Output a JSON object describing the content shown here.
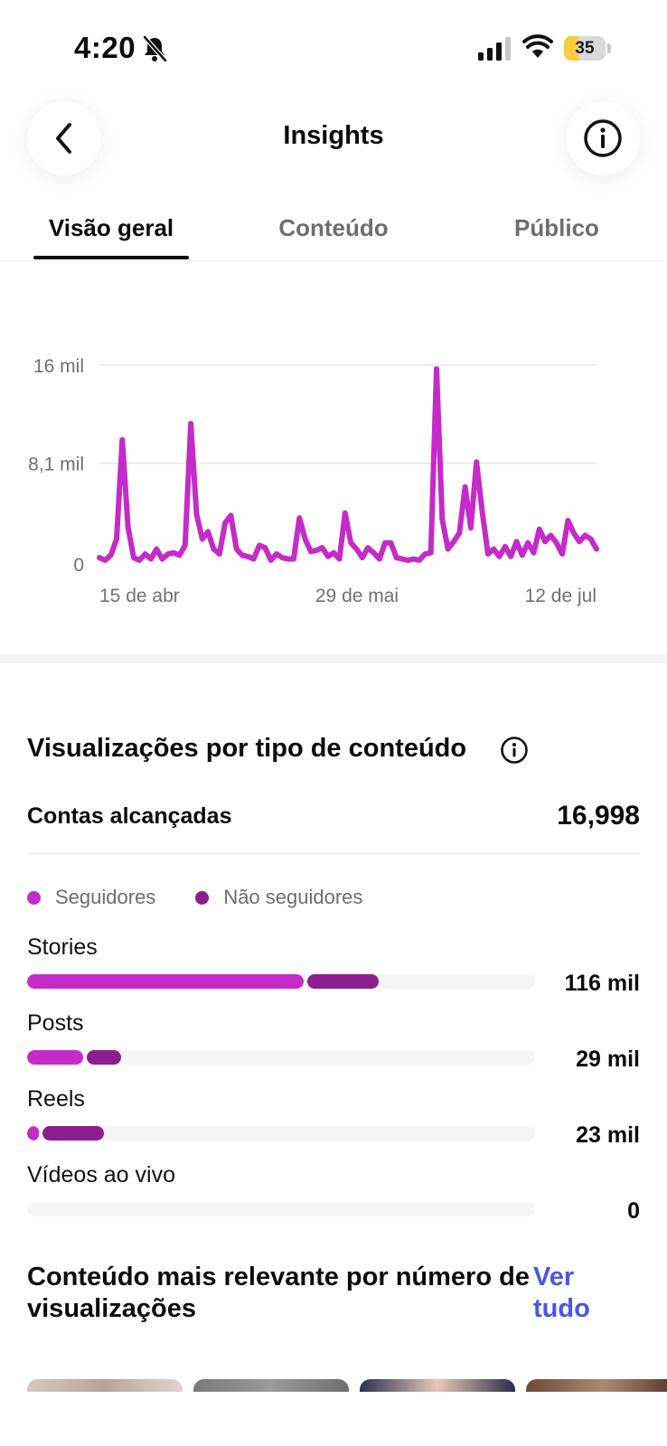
{
  "status_bar": {
    "time": "4:20",
    "battery_level": "35"
  },
  "header": {
    "title": "Insights",
    "back_icon": "chevron-left-icon",
    "info_icon": "info-icon"
  },
  "tabs": [
    {
      "label": "Visão geral",
      "active": true
    },
    {
      "label": "Conteúdo",
      "active": false
    },
    {
      "label": "Público",
      "active": false
    }
  ],
  "chart_data": {
    "type": "line",
    "series": [
      {
        "color": "#c52bc8",
        "values": [
          500,
          300,
          700,
          2000,
          10000,
          3000,
          500,
          300,
          800,
          400,
          1200,
          400,
          800,
          900,
          700,
          1500,
          11300,
          4000,
          2000,
          2600,
          1200,
          800,
          3300,
          3900,
          1200,
          700,
          600,
          400,
          1500,
          1300,
          300,
          800,
          500,
          400,
          400,
          3700,
          2000,
          1000,
          1100,
          1300,
          600,
          900,
          400,
          4100,
          1700,
          1200,
          500,
          1300,
          900,
          400,
          1700,
          1700,
          500,
          400,
          300,
          400,
          300,
          800,
          900,
          15700,
          3600,
          1200,
          1800,
          2500,
          6200,
          2900,
          8200,
          4200,
          800,
          1200,
          600,
          1400,
          600,
          1800,
          700,
          1700,
          900,
          2800,
          1800,
          2300,
          1700,
          800,
          3500,
          2500,
          1800,
          2300,
          2000,
          1200
        ]
      }
    ],
    "x_tick_labels": [
      "15 de abr",
      "29 de mai",
      "12 de jul"
    ],
    "y_tick_labels": [
      "16 mil",
      "8,1 mil",
      "0"
    ],
    "y_tick_values": [
      16000,
      8100,
      0
    ],
    "ylim": [
      0,
      16000
    ],
    "grid": true
  },
  "views_by_type": {
    "title": "Visualizações por tipo de conteúdo",
    "reach_label": "Contas alcançadas",
    "reach_value": "16,998",
    "legend": [
      {
        "label": "Seguidores",
        "color": "#c52bc8"
      },
      {
        "label": "Não seguidores",
        "color": "#8d1e8f"
      }
    ],
    "rows": [
      {
        "label": "Stories",
        "value": "116 mil",
        "followers_fraction": 0.545,
        "non_followers_fraction": 0.14
      },
      {
        "label": "Posts",
        "value": "29 mil",
        "followers_fraction": 0.11,
        "non_followers_fraction": 0.068
      },
      {
        "label": "Reels",
        "value": "23 mil",
        "followers_fraction": 0.024,
        "non_followers_fraction": 0.12
      },
      {
        "label": "Vídeos ao vivo",
        "value": "0",
        "followers_fraction": 0,
        "non_followers_fraction": 0
      }
    ]
  },
  "relevant_content": {
    "title": "Conteúdo mais relevante por número de visualizações",
    "see_all_label": "Ver tudo"
  }
}
